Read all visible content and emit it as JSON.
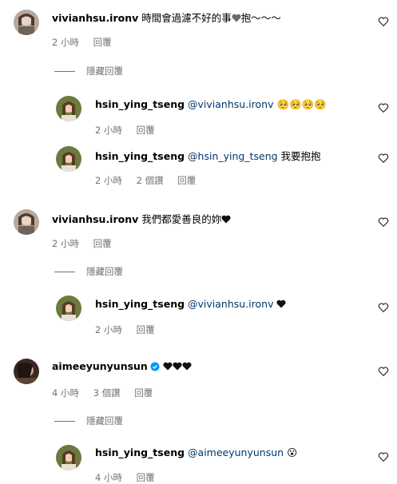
{
  "comments": [
    {
      "username": "vivianhsu.ironv",
      "mention": "",
      "text": "時間會過濾不好的事",
      "text_after": "抱～～～",
      "time": "2 小時",
      "likes": "",
      "reply_label": "回覆"
    },
    {
      "username": "hsin_ying_tseng",
      "mention": "@vivianhsu.ironv",
      "text": "🥺🥺🥺🥺",
      "time": "2 小時",
      "likes": "",
      "reply_label": "回覆"
    },
    {
      "username": "hsin_ying_tseng",
      "mention": "@hsin_ying_tseng",
      "text": "我要抱抱",
      "time": "2 小時",
      "likes": "2 個讚",
      "reply_label": "回覆"
    },
    {
      "username": "vivianhsu.ironv",
      "mention": "",
      "text": "我們都愛善良的妳",
      "time": "2 小時",
      "likes": "",
      "reply_label": "回覆"
    },
    {
      "username": "hsin_ying_tseng",
      "mention": "@vivianhsu.ironv",
      "text": "",
      "time": "2 小時",
      "likes": "",
      "reply_label": "回覆"
    },
    {
      "username": "aimeeyunyunsun",
      "mention": "",
      "text": "",
      "time": "4 小時",
      "likes": "3 個讚",
      "reply_label": "回覆"
    },
    {
      "username": "hsin_ying_tseng",
      "mention": "@aimeeyunyunsun",
      "text": "😮",
      "time": "4 小時",
      "likes": "",
      "reply_label": "回覆"
    }
  ],
  "hide_replies_label": "隱藏回覆",
  "colors": {
    "meta": "#737373",
    "mention": "#00376b",
    "verified": "#0095f6"
  }
}
